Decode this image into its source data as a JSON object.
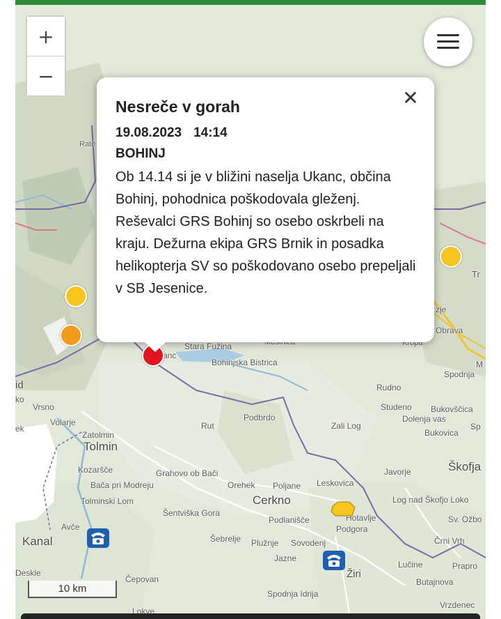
{
  "map": {
    "labels": {
      "rate": "Rate",
      "stara_fuzina": "Stara Fužina",
      "ukanc": "anc",
      "mostnica": "Mostnica",
      "bohinjska_bistrica": "Bohinjska Bistrica",
      "kropa": "Kropa",
      "zje": "zje",
      "obrava": "Obrava",
      "tr": "Tr",
      "m": "M",
      "spodnja_east": "Spodnja",
      "id": "id",
      "ko": "ko",
      "vrsno": "Vrsno",
      "ek": "ek",
      "volarje": "Volarje",
      "zatolmin": "Zatolmin",
      "tolmin": "Tolmin",
      "rut": "Rut",
      "podbrdo": "Podbrdo",
      "zali_log": "Zali Log",
      "rudno": "Rudno",
      "studeno": "Studeno",
      "bukovscica": "Bukovščica",
      "dolenja_vas": "Dolenja vas",
      "bukovica": "Bukovica",
      "sp": "Sp",
      "skofja": "Škofja",
      "kozarsce": "Kozaršče",
      "grahovo": "Grahovo ob Bači",
      "baca": "Bača pri Modreju",
      "orehek": "Orehek",
      "poljane": "Poljane",
      "leskovica": "Leskovica",
      "javorje": "Javorje",
      "tolminski_lom": "Tolminski Lom",
      "cerkno": "Cerkno",
      "log": "Log nad Škofjo Loko",
      "sentviska": "Šentviška Gora",
      "podlanisce": "Podlanišče",
      "hotavlje": "Hotavlje",
      "podgora": "Podgora",
      "sv_ozbolt": "Sv. Ožbo",
      "avce": "Avče",
      "sebrelje": "Šebrelje",
      "pluznje": "Plužnje",
      "sovodenj": "Sovodenj",
      "crni_vrh": "Črni Vrh",
      "kanal": "Kanal",
      "jazne": "Jazne",
      "lucine": "Lučine",
      "prapro": "Prapro",
      "deskle": "Deskle",
      "zairi": "Žiri",
      "butajnova": "Butajnova",
      "cepovan": "Čepovan",
      "spodnja_idrija": "Spodnja Idrija",
      "vrzdenec": "Vrzdenec",
      "lokve": "Lokve"
    },
    "zoom_in_label": "+",
    "zoom_out_label": "−",
    "scale_label": "10 km"
  },
  "markers": {
    "yellow_color": "#f7c51e",
    "orange_color": "#f29b1c",
    "red_color": "#e4141e",
    "phone_color": "#1f5fb0"
  },
  "popup": {
    "title": "Nesreče v gorah",
    "date": "19.08.2023",
    "time": "14:14",
    "location": "BOHINJ",
    "body": "Ob 14.14 si je v bližini naselja Ukanc, občina Bohinj, pohodnica poškodovala gleženj. Reševalci GRS Bohinj so osebo oskrbeli na kraju. Dežurna ekipa GRS Brnik in posadka helikopterja SV so poškodovano osebo prepeljali v SB Jesenice.",
    "close_label": "✕"
  },
  "colors": {
    "header_green": "#2e8b3c",
    "border_purple": "#7a6aa6",
    "road_yellow": "#f0c430"
  }
}
